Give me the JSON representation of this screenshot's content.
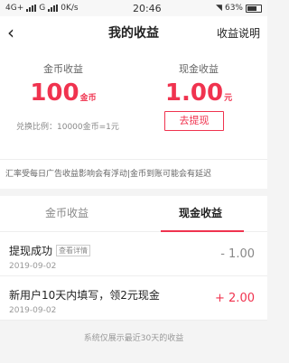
{
  "status_bar": {
    "left": "4G+",
    "sim2": "G",
    "speed": "0K/s",
    "time": "20:46",
    "battery_pct": "63%",
    "battery_level": 0.63
  },
  "nav": {
    "title": "我的收益",
    "right_link": "收益说明"
  },
  "summary": {
    "coin_label": "金币收益",
    "coin_value": "100",
    "coin_unit": "金币",
    "cash_label": "现金收益",
    "cash_value": "1.00",
    "cash_unit": "元",
    "rate_text": "兑换比例：10000金币=1元",
    "withdraw_label": "去提现"
  },
  "notice": "汇率受每日广告收益影响会有浮动|金币到账可能会有延迟",
  "tabs": [
    {
      "label": "金币收益",
      "active": false
    },
    {
      "label": "现金收益",
      "active": true
    }
  ],
  "records": [
    {
      "title": "提现成功",
      "tag": "查看详情",
      "date": "2019-09-02",
      "amount": "- 1.00",
      "sign": "neg"
    },
    {
      "title": "新用户10天内填写，领2元现金",
      "tag": "",
      "date": "2019-09-02",
      "amount": "+ 2.00",
      "sign": "pos"
    }
  ],
  "footer_note": "系统仅展示最近30天的收益",
  "colors": {
    "accent": "#f0334f"
  }
}
